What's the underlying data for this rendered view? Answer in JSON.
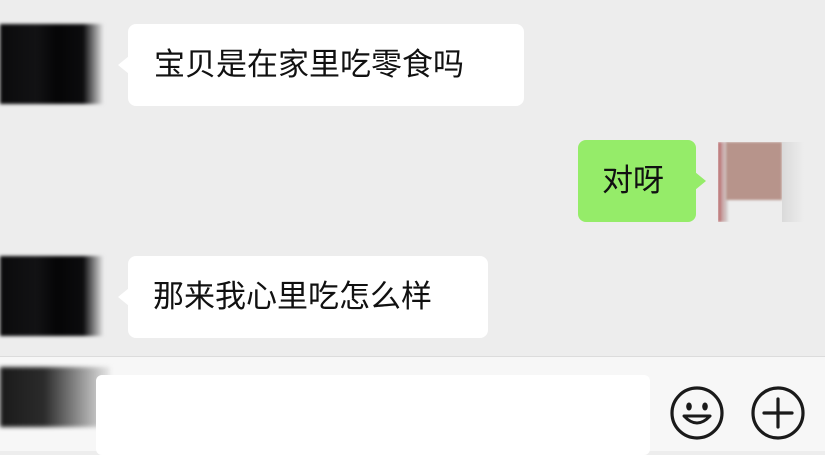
{
  "messages": [
    {
      "side": "left",
      "text": "宝贝是在家里吃零食吗"
    },
    {
      "side": "right",
      "text": "对呀"
    },
    {
      "side": "left",
      "text": "那来我心里吃怎么样"
    }
  ],
  "input": {
    "value": "",
    "placeholder": ""
  },
  "icons": {
    "emoji": "emoji-icon",
    "plus": "plus-icon"
  },
  "colors": {
    "background": "#ededed",
    "incoming_bubble": "#ffffff",
    "outgoing_bubble": "#95ec69",
    "input_bar": "#f7f7f7",
    "icon_stroke": "#1a1a1a"
  }
}
